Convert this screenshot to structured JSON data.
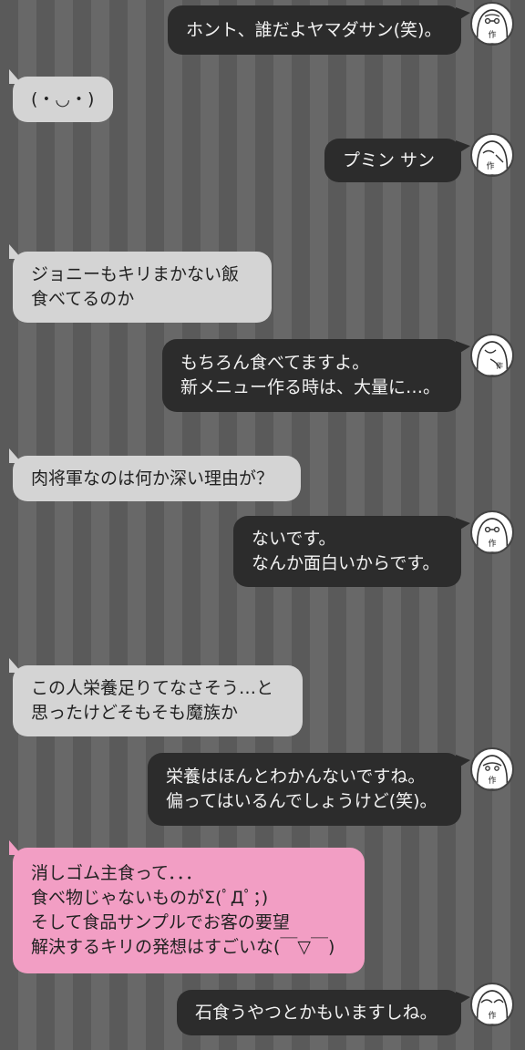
{
  "messages": [
    {
      "side": "author",
      "text": "ホント、誰だよヤマダサン(笑)。"
    },
    {
      "side": "reader",
      "text": "(・◡・)"
    },
    {
      "side": "author",
      "text": "プミン サン"
    },
    {
      "side": "reader",
      "text": "ジョニーもキリまかない飯\n食べてるのか"
    },
    {
      "side": "author",
      "text": "もちろん食べてますよ。\n新メニュー作る時は、大量に…。"
    },
    {
      "side": "reader",
      "text": "肉将軍なのは何か深い理由が？"
    },
    {
      "side": "author",
      "text": "ないです。\nなんか面白いからです。"
    },
    {
      "side": "reader",
      "text": "この人栄養足りてなさそう…と\n思ったけどそもそも魔族か"
    },
    {
      "side": "author",
      "text": "栄養はほんとわかんないですね。\n偏ってはいるんでしょうけど(笑)。"
    },
    {
      "side": "reader",
      "text": "消しゴム主食って．．．\n食べ物じゃないものがΣ(ﾟДﾟ；)\nそして食品サンプルでお客の要望\n解決するキリの発想はすごいな(￣▽￣)",
      "highlight": true
    },
    {
      "side": "author",
      "text": "石食うやつとかもいますしね。"
    }
  ],
  "avatar": {
    "icon": "author-avatar-icon",
    "badge": "作"
  },
  "colors": {
    "author_bubble": "#2c2c2c",
    "reader_bubble": "#d4d4d4",
    "highlight_bubble": "#f29ec4",
    "stripe_dark": "#5a5a5a",
    "stripe_light": "#686868"
  }
}
